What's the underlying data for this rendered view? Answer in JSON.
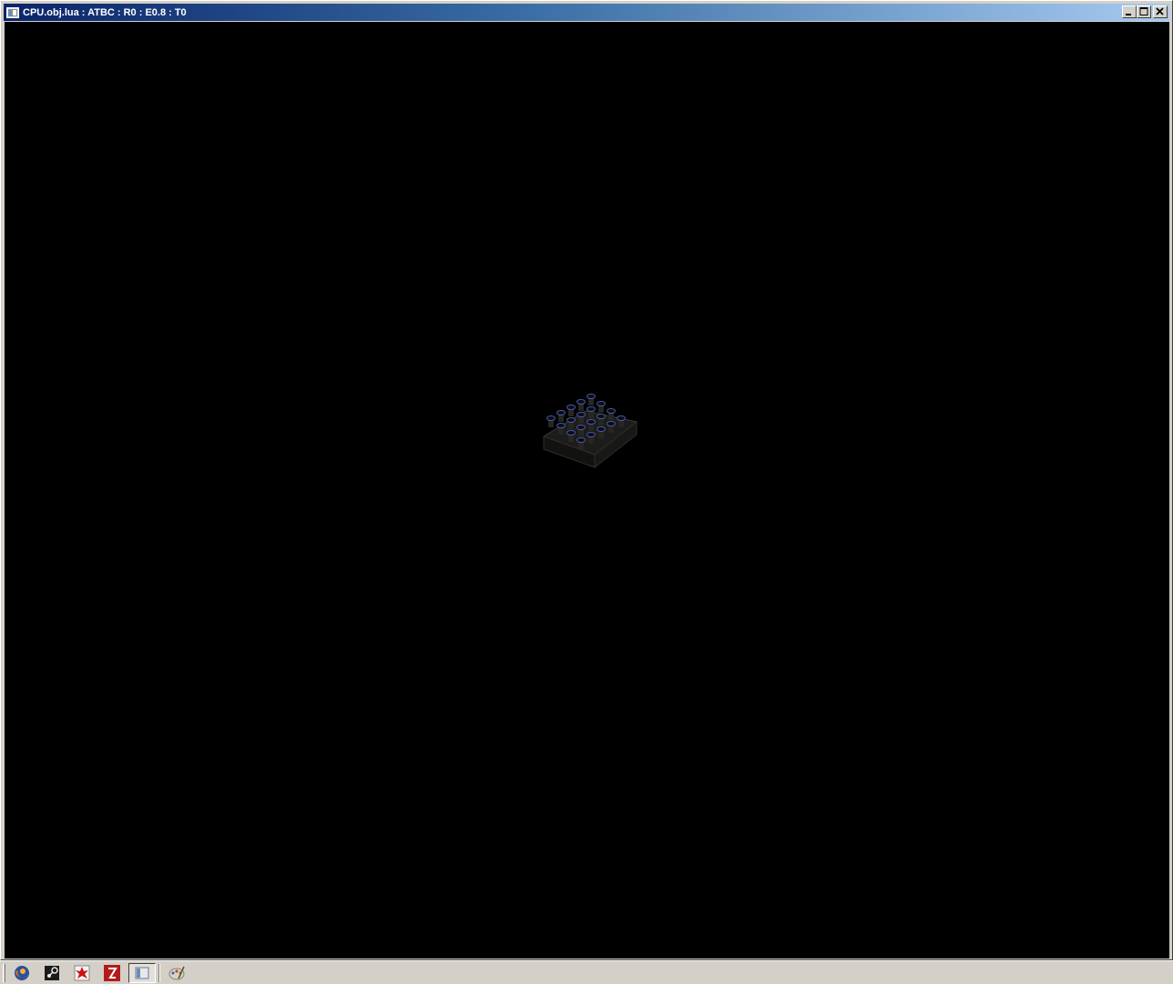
{
  "window": {
    "title": "CPU.obj.lua : ATBC : R0 : E0.8 : T0",
    "buttons": {
      "minimize": "_",
      "maximize": "□",
      "close": "✕"
    }
  },
  "viewport": {
    "background": "#000000",
    "object": "cpu-model"
  },
  "taskbar": {
    "items": [
      {
        "name": "firefox-icon",
        "active": false
      },
      {
        "name": "steam-icon",
        "active": false
      },
      {
        "name": "splash-app-icon",
        "active": false
      },
      {
        "name": "filezilla-icon",
        "active": false
      },
      {
        "name": "window-app-icon",
        "active": true
      },
      {
        "name": "paint-icon",
        "active": false
      }
    ]
  }
}
